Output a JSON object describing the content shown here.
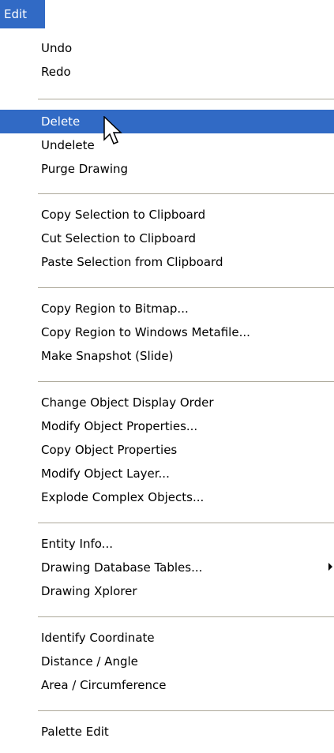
{
  "menubar": {
    "title": "Edit"
  },
  "menu": {
    "items": [
      {
        "label": "Undo"
      },
      {
        "label": "Redo"
      },
      {
        "label": "Delete",
        "highlighted": true
      },
      {
        "label": "Undelete"
      },
      {
        "label": "Purge Drawing"
      },
      {
        "label": "Copy Selection to Clipboard"
      },
      {
        "label": "Cut Selection to Clipboard"
      },
      {
        "label": "Paste Selection from Clipboard"
      },
      {
        "label": "Copy Region to Bitmap..."
      },
      {
        "label": "Copy Region to Windows Metafile..."
      },
      {
        "label": "Make Snapshot (Slide)"
      },
      {
        "label": "Change Object Display Order"
      },
      {
        "label": "Modify Object Properties..."
      },
      {
        "label": "Copy Object Properties"
      },
      {
        "label": "Modify Object Layer..."
      },
      {
        "label": "Explode Complex Objects..."
      },
      {
        "label": "Entity Info..."
      },
      {
        "label": "Drawing Database Tables...",
        "has_submenu": true
      },
      {
        "label": "Drawing Xplorer"
      },
      {
        "label": "Identify Coordinate"
      },
      {
        "label": "Distance / Angle"
      },
      {
        "label": "Area / Circumference"
      },
      {
        "label": "Palette Edit"
      }
    ]
  },
  "colors": {
    "highlight": "#316ac5",
    "separator": "#aca899"
  },
  "icons": {
    "cursor": "arrow-cursor-icon",
    "submenu": "submenu-arrow-icon"
  }
}
